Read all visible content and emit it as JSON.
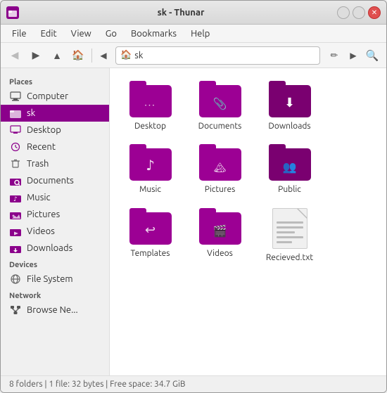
{
  "window": {
    "title": "sk - Thunar",
    "icon": "📁"
  },
  "controls": {
    "minimize": "",
    "maximize": "",
    "close": "✕"
  },
  "menubar": {
    "items": [
      "File",
      "Edit",
      "View",
      "Go",
      "Bookmarks",
      "Help"
    ]
  },
  "toolbar": {
    "back_title": "back",
    "forward_title": "forward",
    "up_title": "up",
    "home_title": "home",
    "location": "sk",
    "edit_title": "edit",
    "search_title": "search"
  },
  "sidebar": {
    "sections": [
      {
        "label": "Places",
        "items": [
          {
            "id": "computer",
            "label": "Computer",
            "icon": "🖥"
          },
          {
            "id": "sk",
            "label": "sk",
            "icon": "🏠",
            "active": true
          },
          {
            "id": "desktop",
            "label": "Desktop",
            "icon": "🖥"
          },
          {
            "id": "recent",
            "label": "Recent",
            "icon": "🕐"
          },
          {
            "id": "trash",
            "label": "Trash",
            "icon": "🗑"
          },
          {
            "id": "documents",
            "label": "Documents",
            "icon": "📋"
          },
          {
            "id": "music",
            "label": "Music",
            "icon": "🎵"
          },
          {
            "id": "pictures",
            "label": "Pictures",
            "icon": "🖼"
          },
          {
            "id": "videos",
            "label": "Videos",
            "icon": "🎬"
          },
          {
            "id": "downloads",
            "label": "Downloads",
            "icon": "⬇"
          }
        ]
      },
      {
        "label": "Devices",
        "items": [
          {
            "id": "filesystem",
            "label": "File System",
            "icon": "💿"
          }
        ]
      },
      {
        "label": "Network",
        "items": [
          {
            "id": "browse-network",
            "label": "Browse Ne...",
            "icon": "🌐"
          }
        ]
      }
    ]
  },
  "files": [
    {
      "id": "desktop",
      "name": "Desktop",
      "type": "folder",
      "symbol": "···"
    },
    {
      "id": "documents",
      "name": "Documents",
      "type": "folder",
      "symbol": "📎"
    },
    {
      "id": "downloads",
      "name": "Downloads",
      "type": "folder",
      "symbol": "⬇"
    },
    {
      "id": "music",
      "name": "Music",
      "type": "folder",
      "symbol": "♪"
    },
    {
      "id": "pictures",
      "name": "Pictures",
      "type": "folder",
      "symbol": "🏔"
    },
    {
      "id": "public",
      "name": "Public",
      "type": "folder",
      "symbol": "👥"
    },
    {
      "id": "templates",
      "name": "Templates",
      "type": "folder",
      "symbol": "↩"
    },
    {
      "id": "videos",
      "name": "Videos",
      "type": "folder",
      "symbol": "🎬"
    },
    {
      "id": "recieved",
      "name": "Recieved.txt",
      "type": "file"
    }
  ],
  "statusbar": {
    "text": "8 folders | 1 file: 32 bytes | Free space: 34.7 GiB"
  }
}
